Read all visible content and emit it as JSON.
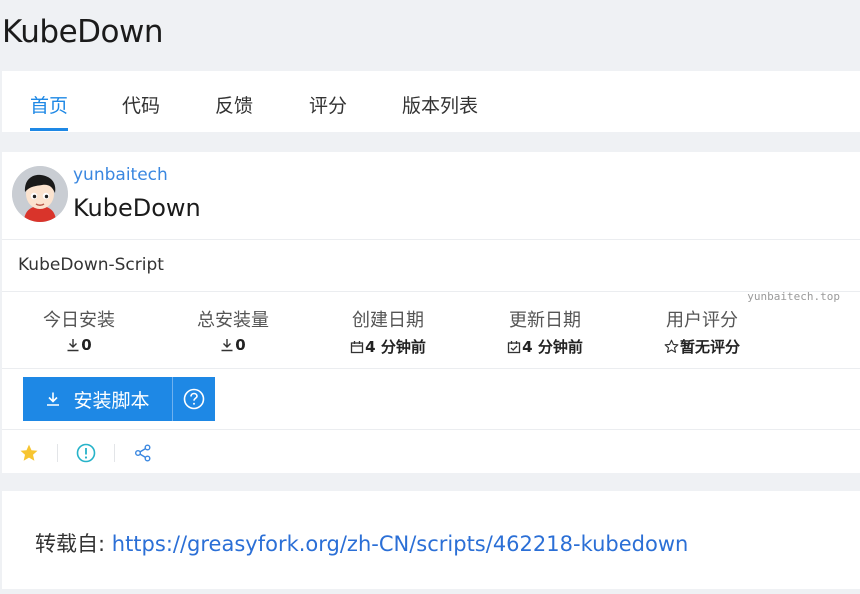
{
  "page": {
    "title": "KubeDown"
  },
  "tabs": [
    {
      "label": "首页",
      "active": true
    },
    {
      "label": "代码"
    },
    {
      "label": "反馈"
    },
    {
      "label": "评分"
    },
    {
      "label": "版本列表"
    }
  ],
  "script": {
    "author": "yunbaitech",
    "name": "KubeDown",
    "description": "KubeDown-Script",
    "watermark": "yunbaitech.top"
  },
  "stats": [
    {
      "label": "今日安装",
      "value": "0",
      "icon": "download-icon"
    },
    {
      "label": "总安装量",
      "value": "0",
      "icon": "download-icon"
    },
    {
      "label": "创建日期",
      "value": "4 分钟前",
      "icon": "calendar-icon"
    },
    {
      "label": "更新日期",
      "value": "4 分钟前",
      "icon": "calendar-check-icon"
    },
    {
      "label": "用户评分",
      "value": "暂无评分",
      "icon": "star-outline-icon"
    }
  ],
  "actions": {
    "install_label": "安装脚本",
    "accent": "#1e88e5"
  },
  "source": {
    "prefix": "转载自: ",
    "url": "https://greasyfork.org/zh-CN/scripts/462218-kubedown"
  }
}
